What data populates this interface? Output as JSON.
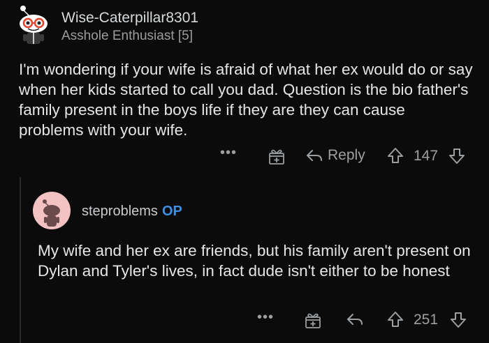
{
  "comment": {
    "username": "Wise-Caterpillar8301",
    "flair": "Asshole Enthusiast [5]",
    "body": "I'm wondering if your wife is afraid of what her ex would do or say when her kids started to call you dad. Question is the bio father's family present in the boys life if they are they can cause problems with your wife.",
    "actions": {
      "more": "•••",
      "reply_label": "Reply",
      "votes": "147"
    }
  },
  "reply": {
    "username": "steproblems",
    "op_badge": "OP",
    "body": "My wife and her ex are friends, but his family aren't present on Dylan and Tyler's lives, in fact dude isn't either to be honest",
    "actions": {
      "more": "•••",
      "votes": "251"
    }
  },
  "colors": {
    "background": "#0b0b0b",
    "op_accent": "#3f8fe3",
    "avatar2_bg": "#f5c2c4"
  }
}
